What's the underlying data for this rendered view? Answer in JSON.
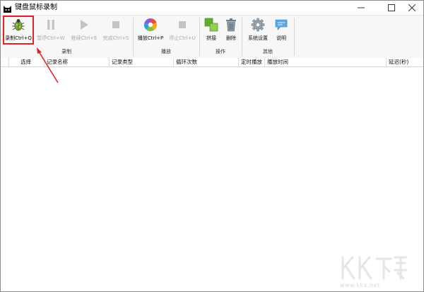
{
  "window": {
    "title": "键盘鼠标录制",
    "icon": "cat-face-icon"
  },
  "ribbon": {
    "groups": [
      {
        "label": "录制",
        "buttons": [
          {
            "label": "录制Ctrl+Q",
            "icon": "bug-icon",
            "enabled": true,
            "highlighted": true
          },
          {
            "label": "暂停Ctrl+W",
            "icon": "pause-icon",
            "enabled": false
          },
          {
            "label": "继续Ctrl+E",
            "icon": "play-icon",
            "enabled": false
          },
          {
            "label": "完成Ctrl+S",
            "icon": "stop-icon",
            "enabled": false
          }
        ]
      },
      {
        "label": "播放",
        "buttons": [
          {
            "label": "播放Ctrl+P",
            "icon": "color-disc-icon",
            "enabled": true
          },
          {
            "label": "停止Ctrl+U",
            "icon": "stop-icon",
            "enabled": false
          }
        ]
      },
      {
        "label": "操作",
        "buttons": [
          {
            "label": "拼接",
            "icon": "merge-blocks-icon",
            "enabled": true
          },
          {
            "label": "删除",
            "icon": "trash-icon",
            "enabled": true
          }
        ]
      },
      {
        "label": "其他",
        "buttons": [
          {
            "label": "系统设置",
            "icon": "gear-icon",
            "enabled": true
          },
          {
            "label": "说明",
            "icon": "speech-bubble-icon",
            "enabled": true
          }
        ]
      }
    ]
  },
  "table": {
    "columns": [
      "选择",
      "记录名称",
      "记录类型",
      "循环次数",
      "定时播放",
      "播放时间",
      "延迟(秒)"
    ],
    "rows": []
  },
  "watermark": {
    "logo_text": "KK下载",
    "url": "www.kkx.net"
  },
  "colors": {
    "highlight_border": "#e0232a",
    "annotation_arrow": "#e0232a",
    "disabled_text": "#a9a9a9"
  }
}
